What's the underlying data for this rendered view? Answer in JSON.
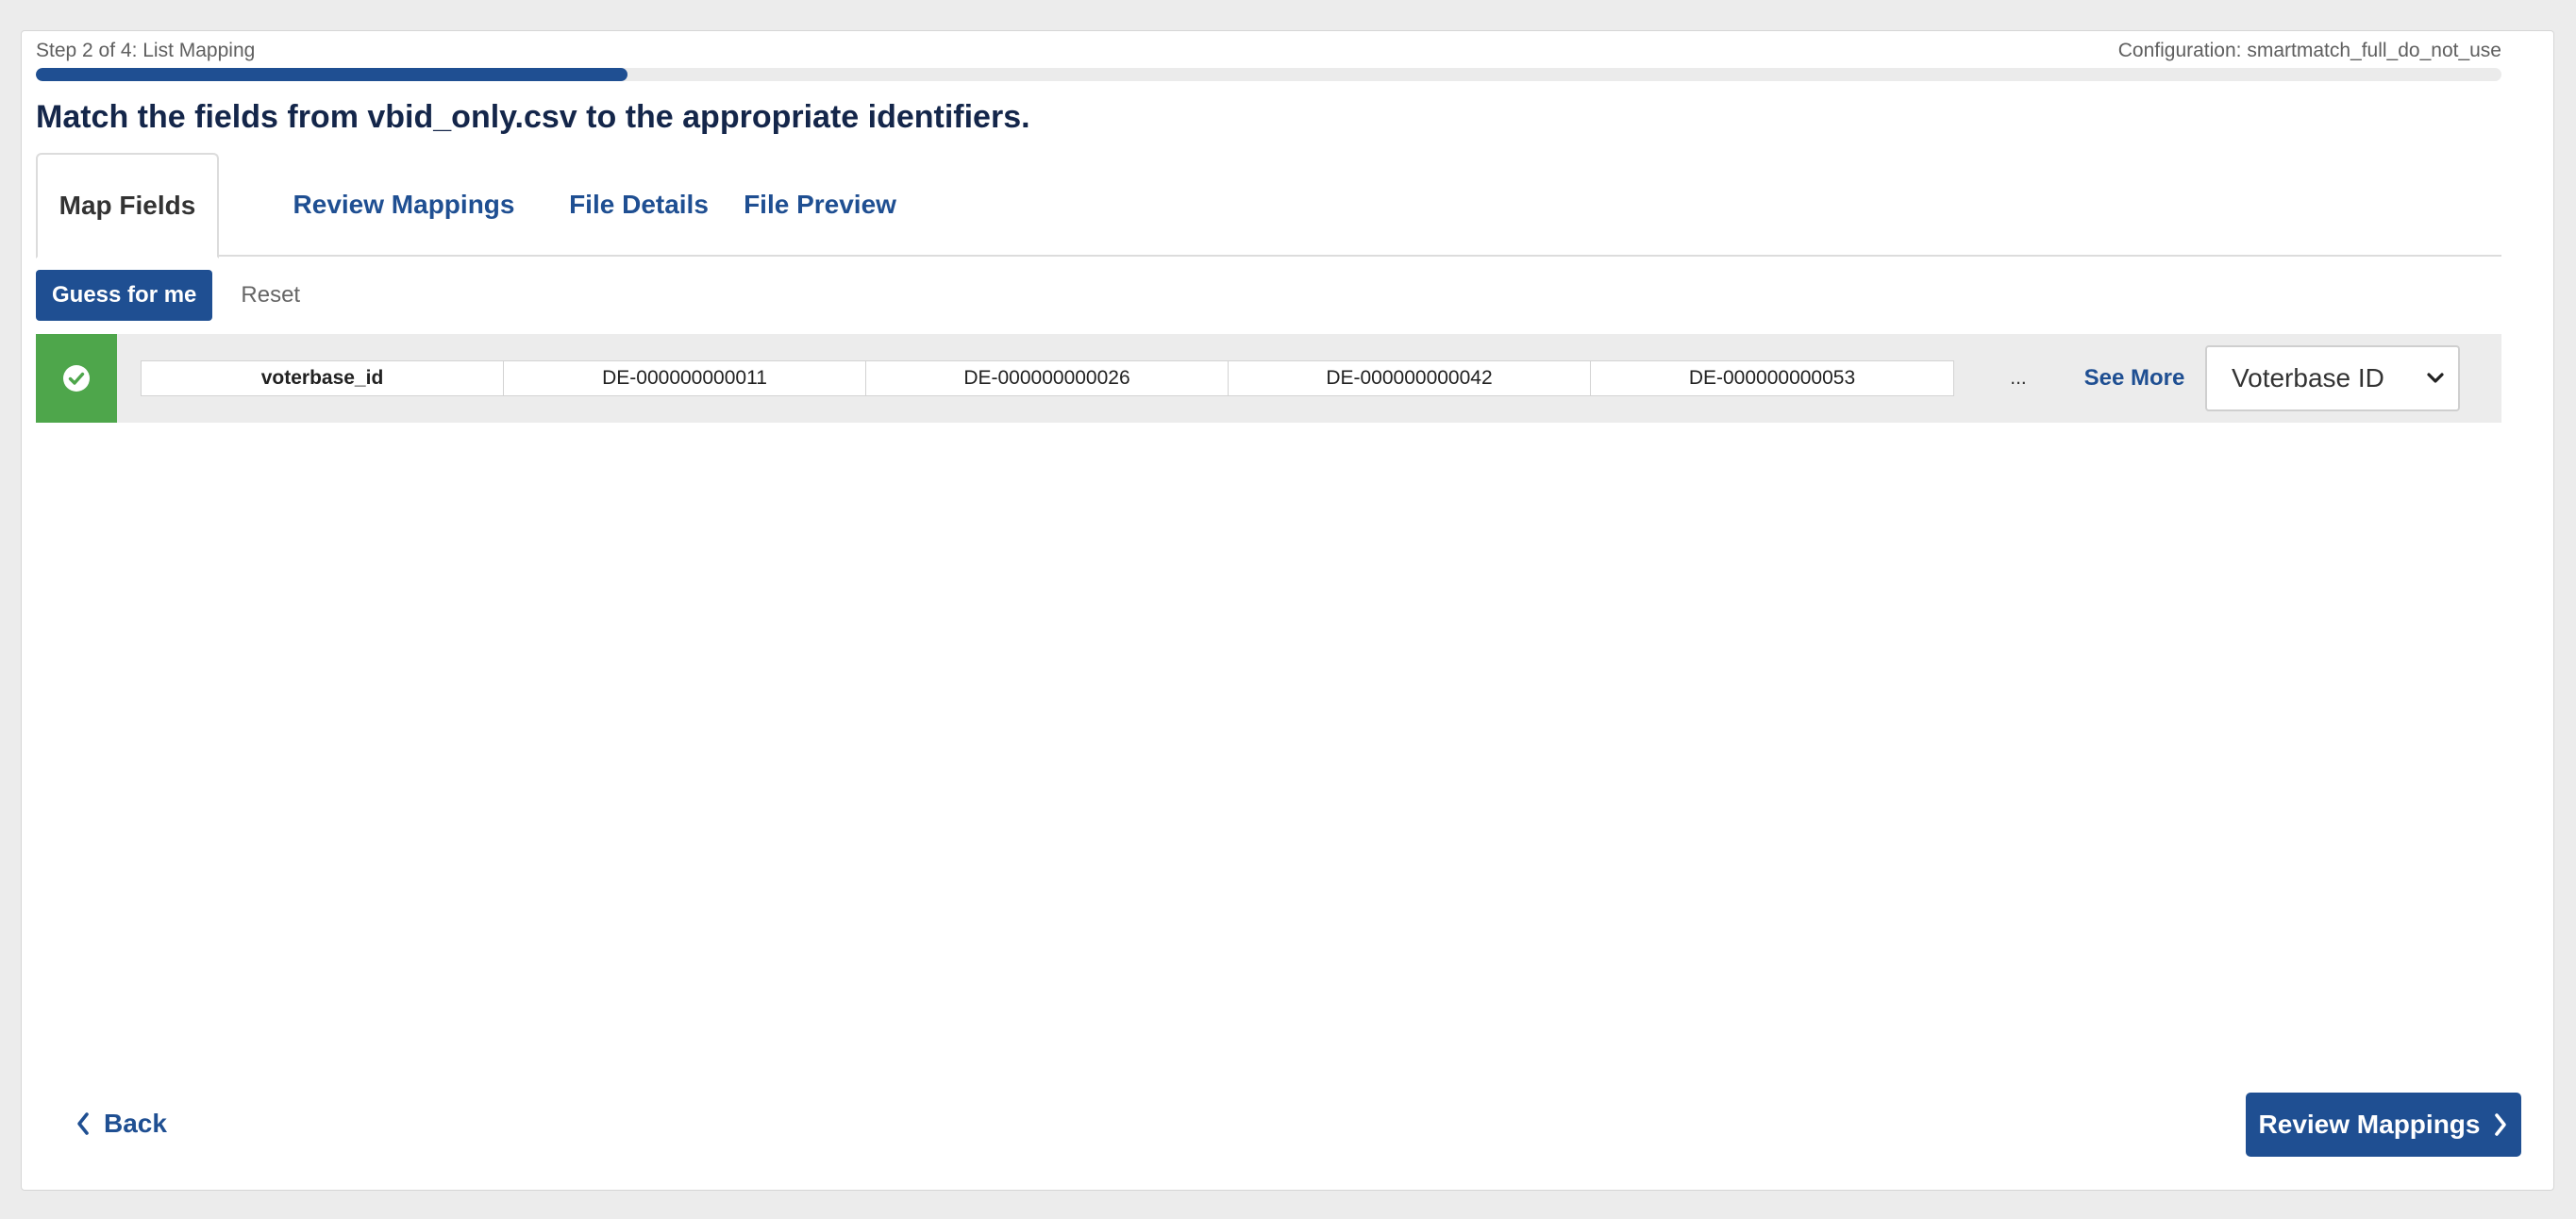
{
  "wizard": {
    "step_text": "Step 2 of 4: List Mapping",
    "configuration_text": "Configuration: smartmatch_full_do_not_use",
    "progress_fraction": 0.24,
    "heading": "Match the fields from vbid_only.csv to the appropriate identifiers."
  },
  "tabs": [
    {
      "label": "Map Fields",
      "active": true
    },
    {
      "label": "Review Mappings",
      "active": false
    },
    {
      "label": "File Details",
      "active": false
    },
    {
      "label": "File Preview",
      "active": false
    }
  ],
  "actions": {
    "guess_label": "Guess for me",
    "reset_label": "Reset"
  },
  "mapping_row": {
    "status_icon": "check-circle-icon",
    "status_color": "#4ea64b",
    "column_name": "voterbase_id",
    "samples": [
      "DE-000000000011",
      "DE-000000000026",
      "DE-000000000042",
      "DE-000000000053"
    ],
    "ellipsis": "...",
    "see_more_label": "See More",
    "selected_identifier": "Voterbase ID"
  },
  "footer": {
    "back_label": "Back",
    "next_label": "Review Mappings"
  },
  "colors": {
    "accent": "#1f4f92",
    "success": "#4ea64b",
    "heading": "#14264a"
  }
}
